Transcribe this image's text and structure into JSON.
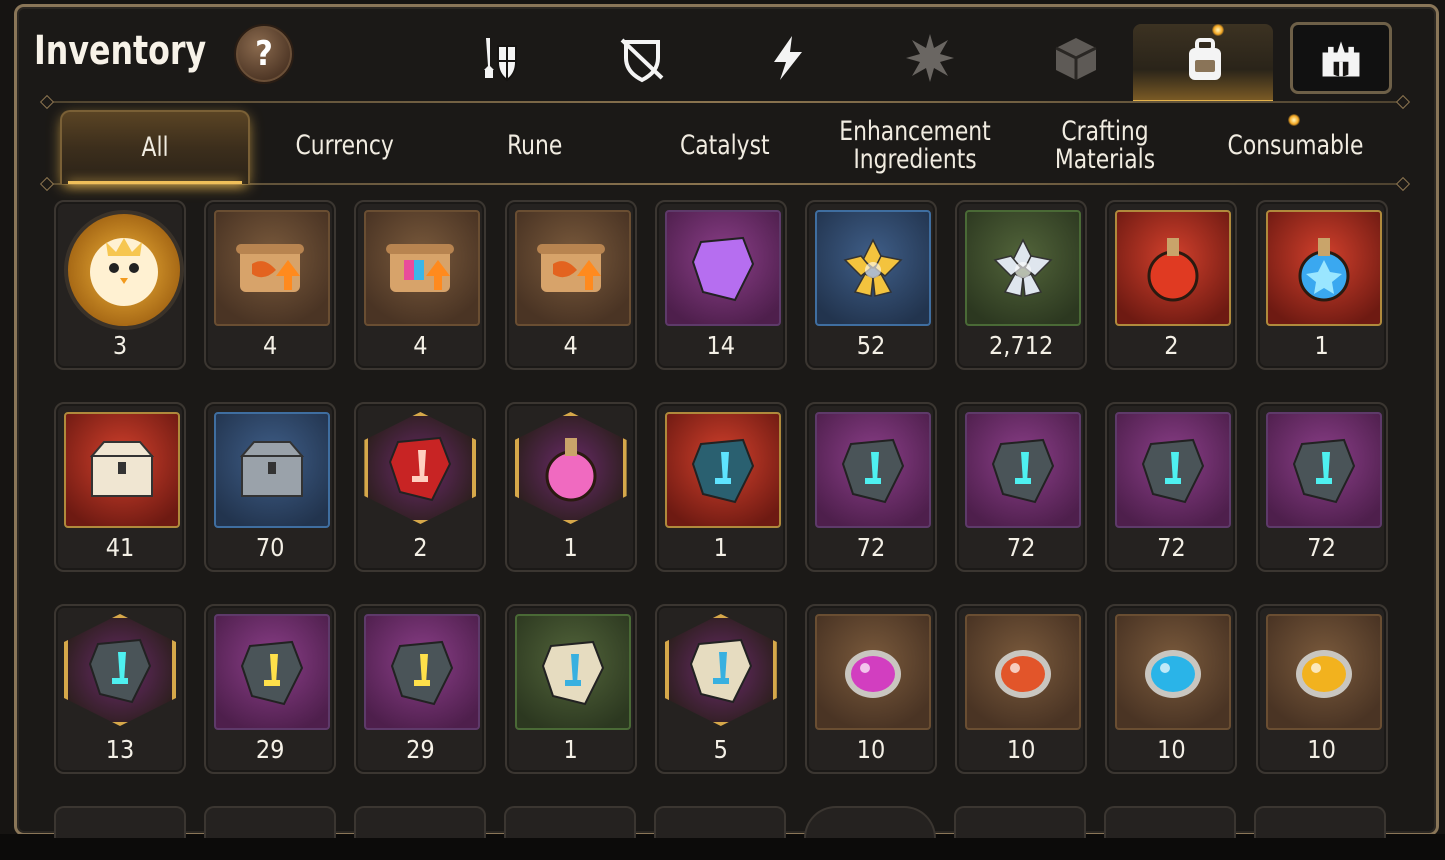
{
  "header": {
    "title": "Inventory",
    "help_label": "?"
  },
  "category_icons": [
    {
      "name": "equipment-icon"
    },
    {
      "name": "disabled-shield-icon"
    },
    {
      "name": "lightning-icon"
    },
    {
      "name": "burst-icon"
    },
    {
      "name": "cube-icon"
    },
    {
      "name": "backpack-icon",
      "active": true
    },
    {
      "name": "guild-castle-icon"
    }
  ],
  "tabs": [
    {
      "label": "All",
      "active": true
    },
    {
      "label": "Currency"
    },
    {
      "label": "Rune"
    },
    {
      "label": "Catalyst"
    },
    {
      "label": "Enhancement Ingredients"
    },
    {
      "label": "Crafting Materials"
    },
    {
      "label": "Consumable"
    }
  ],
  "items": [
    {
      "icon": "chick-coin-icon",
      "count": "3"
    },
    {
      "icon": "scroll-upgrade-icon",
      "count": "4"
    },
    {
      "icon": "rainbow-scroll-icon",
      "count": "4"
    },
    {
      "icon": "scroll-upgrade-icon",
      "count": "4"
    },
    {
      "icon": "purple-crystal-flower-icon",
      "count": "14"
    },
    {
      "icon": "gold-flower-icon",
      "count": "52"
    },
    {
      "icon": "silver-flower-icon",
      "count": "2,712"
    },
    {
      "icon": "red-potion-icon",
      "count": "2"
    },
    {
      "icon": "blue-star-potion-icon",
      "count": "1"
    },
    {
      "icon": "gold-chest-icon",
      "count": "41"
    },
    {
      "icon": "silver-chest-icon",
      "count": "70"
    },
    {
      "icon": "red-crystal-icon",
      "count": "2"
    },
    {
      "icon": "pink-potion-icon",
      "count": "1"
    },
    {
      "icon": "hammer-rune-icon",
      "count": "1"
    },
    {
      "icon": "sword-rune-stone-icon",
      "count": "72"
    },
    {
      "icon": "helmet-rune-stone-icon",
      "count": "72"
    },
    {
      "icon": "armor-rune-stone-icon",
      "count": "72"
    },
    {
      "icon": "boot-rune-stone-icon",
      "count": "72"
    },
    {
      "icon": "star-rune-stone-icon",
      "count": "13"
    },
    {
      "icon": "gold-hammer-stone-icon",
      "count": "29"
    },
    {
      "icon": "gold-blade-stone-icon",
      "count": "29"
    },
    {
      "icon": "sword-tablet-icon",
      "count": "1"
    },
    {
      "icon": "star-tablet-icon",
      "count": "5"
    },
    {
      "icon": "purple-orb-icon",
      "count": "10"
    },
    {
      "icon": "red-orb-icon",
      "count": "10"
    },
    {
      "icon": "blue-orb-icon",
      "count": "10"
    },
    {
      "icon": "yellow-orb-icon",
      "count": "10"
    }
  ],
  "colors": {
    "accent": "#f0c05a",
    "frame": "#8a7658"
  }
}
